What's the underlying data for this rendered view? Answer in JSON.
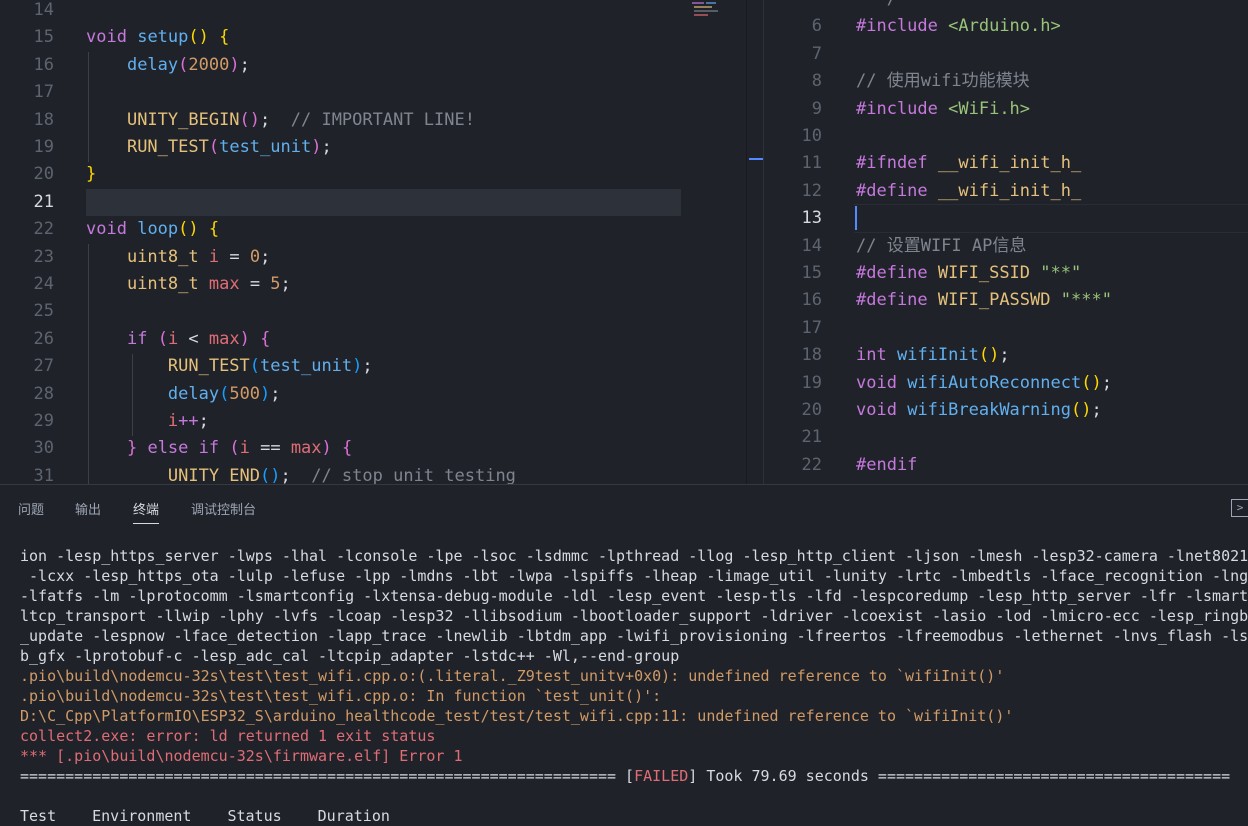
{
  "left_editor": {
    "lines": [
      {
        "n": "14",
        "tokens": []
      },
      {
        "n": "15",
        "tokens": [
          [
            "kw",
            "void"
          ],
          [
            "pun",
            " "
          ],
          [
            "fn",
            "setup"
          ],
          [
            "br1",
            "()"
          ],
          [
            "pun",
            " "
          ],
          [
            "br1",
            "{"
          ]
        ]
      },
      {
        "n": "16",
        "tokens": [
          [
            "pun",
            "    "
          ],
          [
            "fn",
            "delay"
          ],
          [
            "br2",
            "("
          ],
          [
            "num",
            "2000"
          ],
          [
            "br2",
            ")"
          ],
          [
            "pun",
            ";"
          ]
        ]
      },
      {
        "n": "17",
        "tokens": []
      },
      {
        "n": "18",
        "tokens": [
          [
            "pun",
            "    "
          ],
          [
            "ty",
            "UNITY_BEGIN"
          ],
          [
            "br2",
            "()"
          ],
          [
            "pun",
            ";  "
          ],
          [
            "cm",
            "// IMPORTANT LINE!"
          ]
        ]
      },
      {
        "n": "19",
        "tokens": [
          [
            "pun",
            "    "
          ],
          [
            "ty",
            "RUN_TEST"
          ],
          [
            "br2",
            "("
          ],
          [
            "fn",
            "test_unit"
          ],
          [
            "br2",
            ")"
          ],
          [
            "pun",
            ";"
          ]
        ]
      },
      {
        "n": "20",
        "tokens": [
          [
            "br1",
            "}"
          ]
        ]
      },
      {
        "n": "21",
        "tokens": [],
        "active": true
      },
      {
        "n": "22",
        "tokens": [
          [
            "kw",
            "void"
          ],
          [
            "pun",
            " "
          ],
          [
            "fn",
            "loop"
          ],
          [
            "br1",
            "()"
          ],
          [
            "pun",
            " "
          ],
          [
            "br1",
            "{"
          ]
        ]
      },
      {
        "n": "23",
        "tokens": [
          [
            "pun",
            "    "
          ],
          [
            "ty",
            "uint8_t"
          ],
          [
            "pun",
            " "
          ],
          [
            "var",
            "i"
          ],
          [
            "pun",
            " = "
          ],
          [
            "num",
            "0"
          ],
          [
            "pun",
            ";"
          ]
        ]
      },
      {
        "n": "24",
        "tokens": [
          [
            "pun",
            "    "
          ],
          [
            "ty",
            "uint8_t"
          ],
          [
            "pun",
            " "
          ],
          [
            "var",
            "max"
          ],
          [
            "pun",
            " = "
          ],
          [
            "num",
            "5"
          ],
          [
            "pun",
            ";"
          ]
        ]
      },
      {
        "n": "25",
        "tokens": []
      },
      {
        "n": "26",
        "tokens": [
          [
            "pun",
            "    "
          ],
          [
            "kw",
            "if"
          ],
          [
            "pun",
            " "
          ],
          [
            "br2",
            "("
          ],
          [
            "var",
            "i"
          ],
          [
            "pun",
            " < "
          ],
          [
            "var",
            "max"
          ],
          [
            "br2",
            ")"
          ],
          [
            "pun",
            " "
          ],
          [
            "br2",
            "{"
          ]
        ]
      },
      {
        "n": "27",
        "tokens": [
          [
            "pun",
            "        "
          ],
          [
            "ty",
            "RUN_TEST"
          ],
          [
            "br3",
            "("
          ],
          [
            "fn",
            "test_unit"
          ],
          [
            "br3",
            ")"
          ],
          [
            "pun",
            ";"
          ]
        ]
      },
      {
        "n": "28",
        "tokens": [
          [
            "pun",
            "        "
          ],
          [
            "fn",
            "delay"
          ],
          [
            "br3",
            "("
          ],
          [
            "num",
            "500"
          ],
          [
            "br3",
            ")"
          ],
          [
            "pun",
            ";"
          ]
        ]
      },
      {
        "n": "29",
        "tokens": [
          [
            "pun",
            "        "
          ],
          [
            "var",
            "i"
          ],
          [
            "kw",
            "++"
          ],
          [
            "pun",
            ";"
          ]
        ]
      },
      {
        "n": "30",
        "tokens": [
          [
            "pun",
            "    "
          ],
          [
            "br2",
            "}"
          ],
          [
            "pun",
            " "
          ],
          [
            "kw",
            "else if"
          ],
          [
            "pun",
            " "
          ],
          [
            "br2",
            "("
          ],
          [
            "var",
            "i"
          ],
          [
            "pun",
            " == "
          ],
          [
            "var",
            "max"
          ],
          [
            "br2",
            ")"
          ],
          [
            "pun",
            " "
          ],
          [
            "br2",
            "{"
          ]
        ]
      },
      {
        "n": "31",
        "tokens": [
          [
            "pun",
            "        "
          ],
          [
            "ty",
            "UNITY_END"
          ],
          [
            "br3",
            "()"
          ],
          [
            "pun",
            ";  "
          ],
          [
            "cm",
            "// stop unit testing"
          ]
        ]
      }
    ]
  },
  "right_editor": {
    "lines": [
      {
        "n": "",
        "tokens": [
          [
            "cm",
            "  */"
          ]
        ]
      },
      {
        "n": "6",
        "tokens": [
          [
            "kw",
            "#include"
          ],
          [
            "pun",
            " "
          ],
          [
            "inc",
            "<Arduino.h>"
          ]
        ]
      },
      {
        "n": "7",
        "tokens": []
      },
      {
        "n": "8",
        "tokens": [
          [
            "cm",
            "// 使用wifi功能模块"
          ]
        ]
      },
      {
        "n": "9",
        "tokens": [
          [
            "kw",
            "#include"
          ],
          [
            "pun",
            " "
          ],
          [
            "inc",
            "<WiFi.h>"
          ]
        ]
      },
      {
        "n": "10",
        "tokens": []
      },
      {
        "n": "11",
        "tokens": [
          [
            "kw",
            "#ifndef"
          ],
          [
            "pun",
            " "
          ],
          [
            "cmacro",
            "__wifi_init_h_"
          ]
        ]
      },
      {
        "n": "12",
        "tokens": [
          [
            "kw",
            "#define"
          ],
          [
            "pun",
            " "
          ],
          [
            "cmacro",
            "__wifi_init_h_"
          ]
        ]
      },
      {
        "n": "13",
        "tokens": [],
        "active": true
      },
      {
        "n": "14",
        "tokens": [
          [
            "cm",
            "// 设置WIFI AP信息"
          ]
        ]
      },
      {
        "n": "15",
        "tokens": [
          [
            "kw",
            "#define"
          ],
          [
            "pun",
            " "
          ],
          [
            "cmacro",
            "WIFI_SSID"
          ],
          [
            "pun",
            " "
          ],
          [
            "str",
            "\"**\""
          ]
        ]
      },
      {
        "n": "16",
        "tokens": [
          [
            "kw",
            "#define"
          ],
          [
            "pun",
            " "
          ],
          [
            "cmacro",
            "WIFI_PASSWD"
          ],
          [
            "pun",
            " "
          ],
          [
            "str",
            "\"***\""
          ]
        ]
      },
      {
        "n": "17",
        "tokens": []
      },
      {
        "n": "18",
        "tokens": [
          [
            "kw",
            "int"
          ],
          [
            "pun",
            " "
          ],
          [
            "fn",
            "wifiInit"
          ],
          [
            "br1",
            "()"
          ],
          [
            "pun",
            ";"
          ]
        ]
      },
      {
        "n": "19",
        "tokens": [
          [
            "kw",
            "void"
          ],
          [
            "pun",
            " "
          ],
          [
            "fn",
            "wifiAutoReconnect"
          ],
          [
            "br1",
            "()"
          ],
          [
            "pun",
            ";"
          ]
        ]
      },
      {
        "n": "20",
        "tokens": [
          [
            "kw",
            "void"
          ],
          [
            "pun",
            " "
          ],
          [
            "fn",
            "wifiBreakWarning"
          ],
          [
            "br1",
            "()"
          ],
          [
            "pun",
            ";"
          ]
        ]
      },
      {
        "n": "21",
        "tokens": []
      },
      {
        "n": "22",
        "tokens": [
          [
            "kw",
            "#endif"
          ]
        ]
      }
    ]
  },
  "panel": {
    "tabs": [
      "问题",
      "输出",
      "终端",
      "调试控制台"
    ],
    "active_tab": "终端",
    "toggle_icon": ">",
    "terminal_lines": [
      {
        "style": "",
        "text": "ion -lesp_https_server -lwps -lhal -lconsole -lpe -lsoc -lsdmmc -lpthread -llog -lesp_http_client -ljson -lmesh -lesp32-camera -lnet80211"
      },
      {
        "style": "",
        " text": "",
        "text": " -lcxx -lesp_https_ota -lulp -lefuse -lpp -lmdns -lbt -lwpa -lspiffs -lheap -limage_util -lunity -lrtc -lmbedtls -lface_recognition -lngh"
      },
      {
        "style": "",
        "text": "-lfatfs -lm -lprotocomm -lsmartconfig -lxtensa-debug-module -ldl -lesp_event -lesp-tls -lfd -lespcoredump -lesp_http_server -lfr -lsmartc"
      },
      {
        "style": "",
        "text": "ltcp_transport -llwip -lphy -lvfs -lcoap -lesp32 -llibsodium -lbootloader_support -ldriver -lcoexist -lasio -lod -lmicro-ecc -lesp_ringbu"
      },
      {
        "style": "",
        "text": "_update -lespnow -lface_detection -lapp_trace -lnewlib -lbtdm_app -lwifi_provisioning -lfreertos -lfreemodbus -lethernet -lnvs_flash -lsp"
      },
      {
        "style": "",
        "text": "b_gfx -lprotobuf-c -lesp_adc_cal -ltcpip_adapter -lstdc++ -Wl,--end-group"
      },
      {
        "style": "warn",
        "text": ".pio\\build\\nodemcu-32s\\test\\test_wifi.cpp.o:(.literal._Z9test_unitv+0x0): undefined reference to `wifiInit()'"
      },
      {
        "style": "warn",
        "text": ".pio\\build\\nodemcu-32s\\test\\test_wifi.cpp.o: In function `test_unit()':"
      },
      {
        "style": "warn",
        "text": "D:\\C_Cpp\\PlatformIO\\ESP32_S\\arduino_healthcode_test/test/test_wifi.cpp:11: undefined reference to `wifiInit()'"
      },
      {
        "style": "err",
        "text": "collect2.exe: error: ld returned 1 exit status"
      },
      {
        "style": "err",
        "text": "*** [.pio\\build\\nodemcu-32s\\firmware.elf] Error 1"
      }
    ],
    "summary_left": "================================================================== [",
    "summary_failed": "FAILED",
    "summary_right": "] Took 79.69 seconds =======================================",
    "table_header": [
      "Test",
      "Environment",
      "Status",
      "Duration"
    ]
  }
}
